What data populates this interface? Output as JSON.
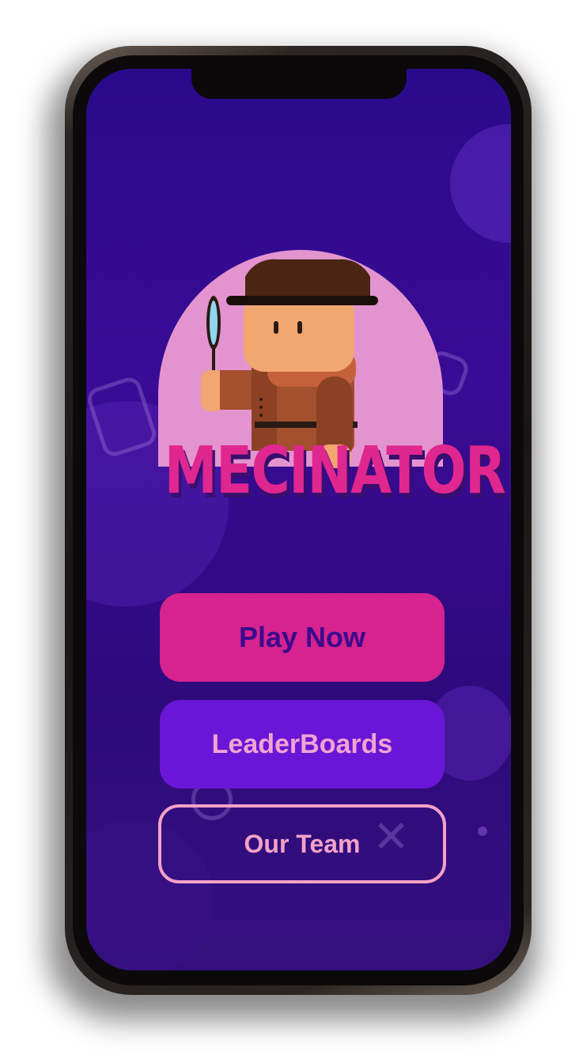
{
  "app": {
    "title": "MECINATOR"
  },
  "menu": {
    "play_label": "Play Now",
    "leaderboards_label": "LeaderBoards",
    "team_label": "Our Team"
  },
  "colors": {
    "background": "#2a0a8a",
    "play_button": "#d6238f",
    "leaderboards_button": "#6a16d6",
    "team_button_outline": "#f4a1c8",
    "logo_text": "#e0268f",
    "logo_backdrop": "#e394cf"
  },
  "icons": {
    "mascot": "detective-mascot-icon",
    "magnifier": "magnifying-glass-icon"
  }
}
